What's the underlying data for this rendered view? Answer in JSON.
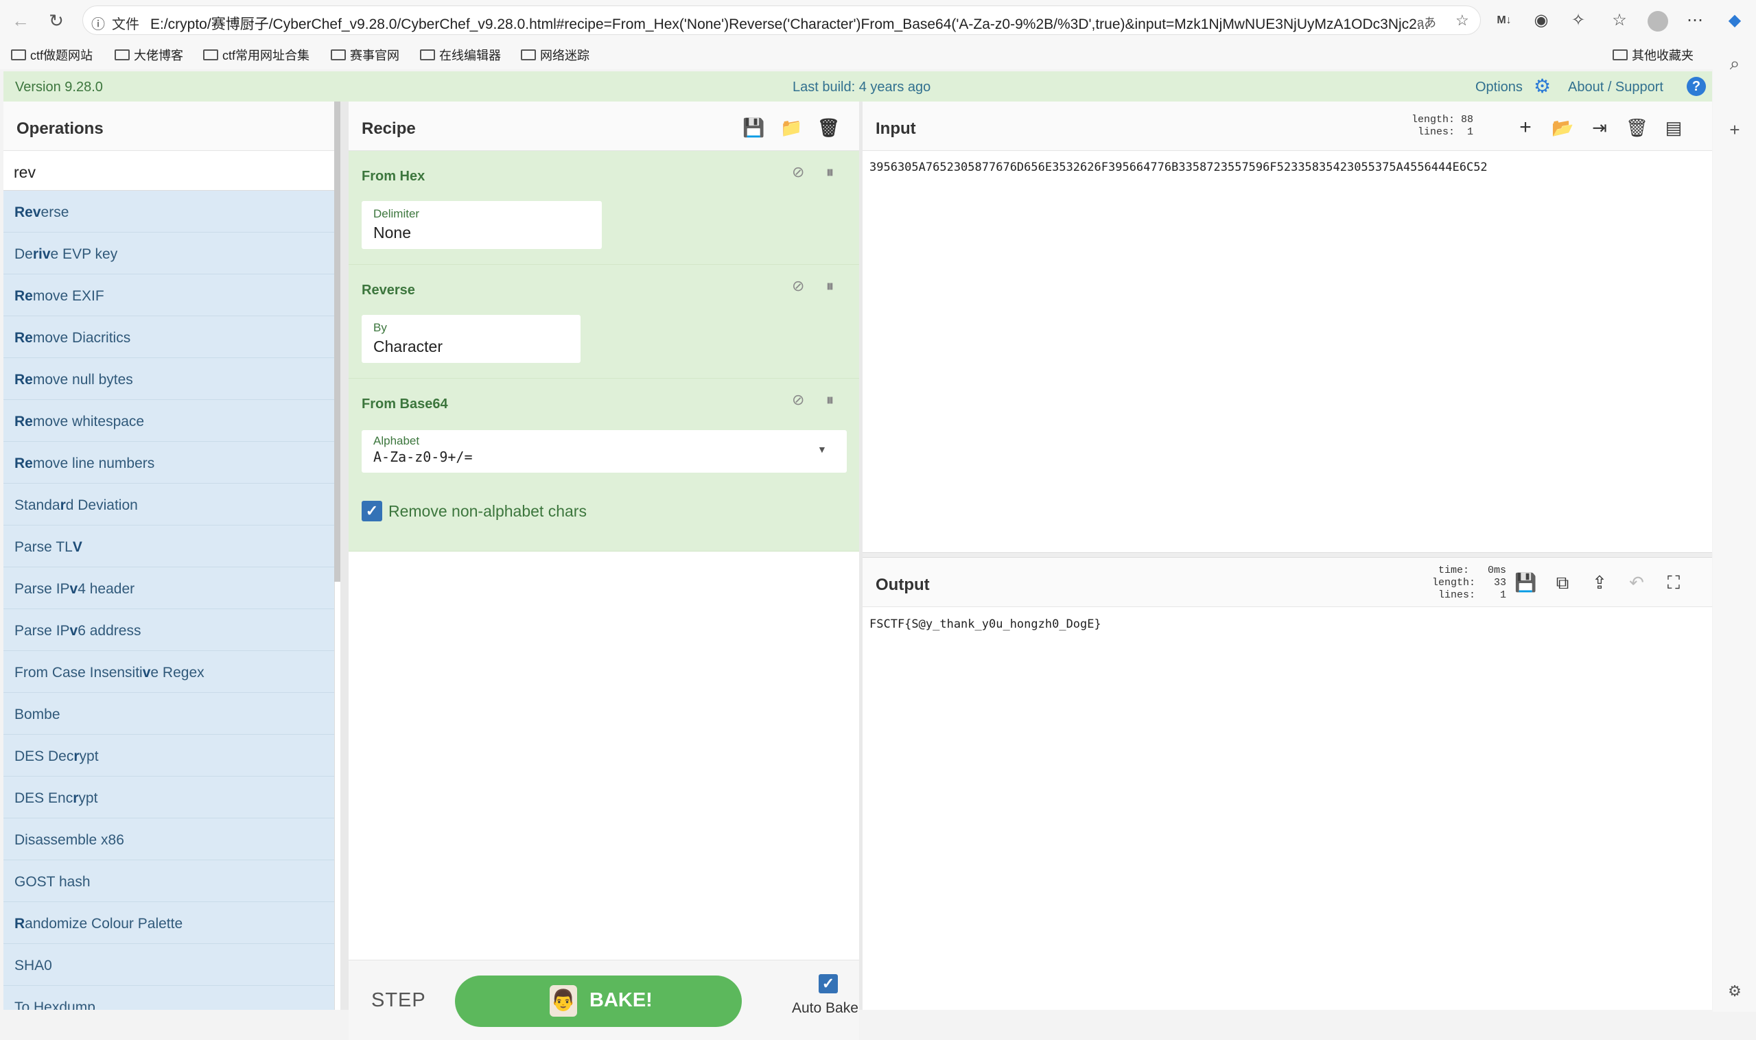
{
  "browser": {
    "file_label": "文件",
    "url": "E:/crypto/赛博厨子/CyberChef_v9.28.0/CyberChef_v9.28.0.html#recipe=From_Hex('None')Reverse('Character')From_Base64('A-Za-z0-9%2B/%3D',true)&input=Mzk1NjMwNUE3NjUyMzA1ODc3Njc2...",
    "read_aloud": "aあ",
    "bookmarks": [
      "ctf做题网站",
      "大佬博客",
      "ctf常用网址合集",
      "赛事官网",
      "在线编辑器",
      "网络迷踪"
    ],
    "other_bookmarks": "其他收藏夹"
  },
  "banner": {
    "version": "Version 9.28.0",
    "last_build": "Last build: 4 years ago",
    "options": "Options",
    "about": "About / Support"
  },
  "operations": {
    "title": "Operations",
    "search_value": "rev",
    "items": [
      {
        "pre": "",
        "b": "Rev",
        "post": "erse"
      },
      {
        "pre": "De",
        "b": "riv",
        "post": "e EVP key"
      },
      {
        "pre": "",
        "b": "Re",
        "post": "move EXIF"
      },
      {
        "pre": "",
        "b": "Re",
        "post": "move Diacritics"
      },
      {
        "pre": "",
        "b": "Re",
        "post": "move null bytes"
      },
      {
        "pre": "",
        "b": "Re",
        "post": "move whitespace"
      },
      {
        "pre": "",
        "b": "Re",
        "post": "move line numbers"
      },
      {
        "pre": "Standa",
        "b": "r",
        "post": "d Deviation"
      },
      {
        "pre": "Parse TL",
        "b": "V",
        "post": ""
      },
      {
        "pre": "Parse IP",
        "b": "v",
        "post": "4 header"
      },
      {
        "pre": "Parse IP",
        "b": "v",
        "post": "6 address"
      },
      {
        "pre": "From Case Insensiti",
        "b": "v",
        "post": "e Regex"
      },
      {
        "pre": "Bombe",
        "b": "",
        "post": ""
      },
      {
        "pre": "DES Dec",
        "b": "r",
        "post": "ypt"
      },
      {
        "pre": "DES Enc",
        "b": "r",
        "post": "ypt"
      },
      {
        "pre": "Disassemble x86",
        "b": "",
        "post": ""
      },
      {
        "pre": "GOST hash",
        "b": "",
        "post": ""
      },
      {
        "pre": "",
        "b": "R",
        "post": "andomize Colour Palette"
      },
      {
        "pre": "SHA0",
        "b": "",
        "post": ""
      },
      {
        "pre": "To Hexdump",
        "b": "",
        "post": ""
      }
    ]
  },
  "recipe": {
    "title": "Recipe",
    "ops": [
      {
        "name": "From Hex",
        "field_label": "Delimiter",
        "field_value": "None"
      },
      {
        "name": "Reverse",
        "field_label": "By",
        "field_value": "Character"
      },
      {
        "name": "From Base64",
        "field_label": "Alphabet",
        "field_value": "A-Za-z0-9+/=",
        "checkbox_label": "Remove non-alphabet chars",
        "checkbox_checked": true
      }
    ],
    "step_label": "STEP",
    "bake_label": "BAKE!",
    "auto_bake_label": "Auto Bake",
    "auto_bake_checked": true
  },
  "input": {
    "title": "Input",
    "length_label": "length:",
    "length": "88",
    "lines_label": "lines:",
    "lines": "1",
    "text": "3956305A7652305877676D656E3532626F395664776B3358723557596F52335835423055375A4556444E6C52"
  },
  "output": {
    "title": "Output",
    "time_label": "time:",
    "time": "0ms",
    "length_label": "length:",
    "length": "33",
    "lines_label": "lines:",
    "lines": "1",
    "text": "FSCTF{S@y_thank_y0u_hongzh0_DogE}"
  },
  "colors": {
    "banner_bg": "#dff0d8",
    "recipe_op_bg": "#dff0d8",
    "op_item_bg": "#dbe9f5",
    "bake_green": "#5cb85c",
    "checkbox_blue": "#3472b6"
  }
}
